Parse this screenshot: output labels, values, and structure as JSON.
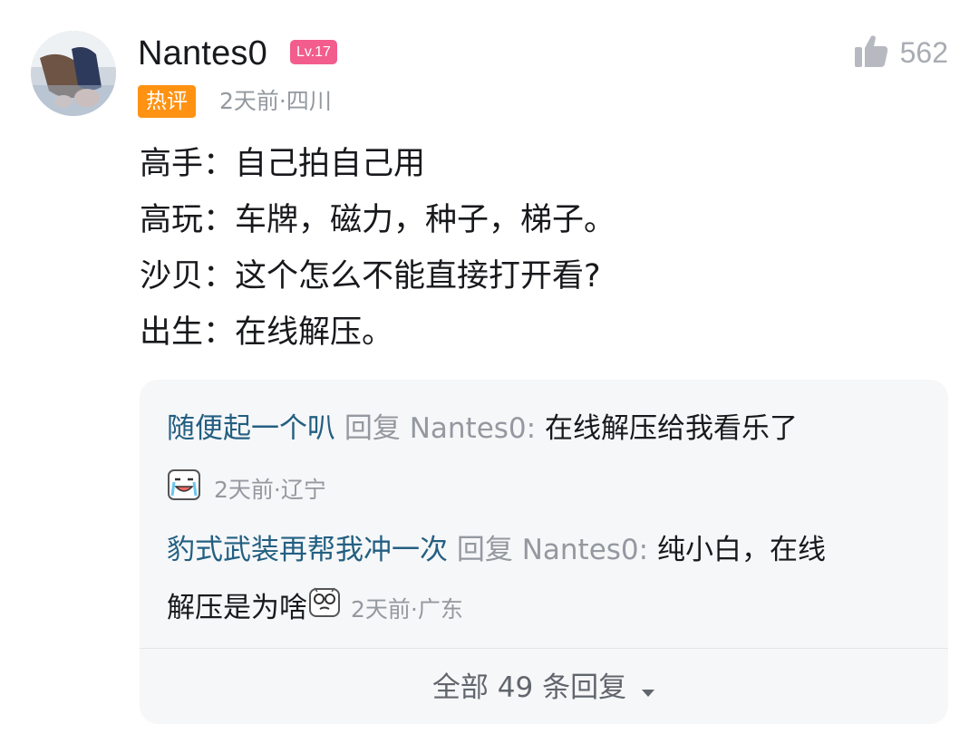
{
  "comment": {
    "username": "Nantes0",
    "level": "Lv.17",
    "likes": "562",
    "hot_badge": "热评",
    "meta": "2天前·四川",
    "lines": [
      "高手：自己拍自己用",
      "高玩：车牌，磁力，种子，梯子。",
      "沙贝：这个怎么不能直接打开看?",
      "出生：在线解压。"
    ]
  },
  "replies": [
    {
      "user": "随便起一个叭",
      "reply_word": "回复",
      "target": "Nantes0:",
      "text": "在线解压给我看乐了",
      "meta": "2天前·辽宁",
      "sticker": "crying-laugh-sticker"
    },
    {
      "user": "豹式武装再帮我冲一次",
      "reply_word": "回复",
      "target": "Nantes0:",
      "text_line1": "纯小白，在线",
      "text_line2": "解压是为啥",
      "meta": "2天前·广东",
      "sticker": "dizzy-face-sticker"
    }
  ],
  "all_replies": "全部 49 条回复",
  "icons": {
    "like": "thumbs-up-icon",
    "expand": "caret-down-icon"
  },
  "colors": {
    "level": "#f25d8e",
    "hot": "#ff9212",
    "username": "#235f82",
    "meta": "#9499a0"
  }
}
